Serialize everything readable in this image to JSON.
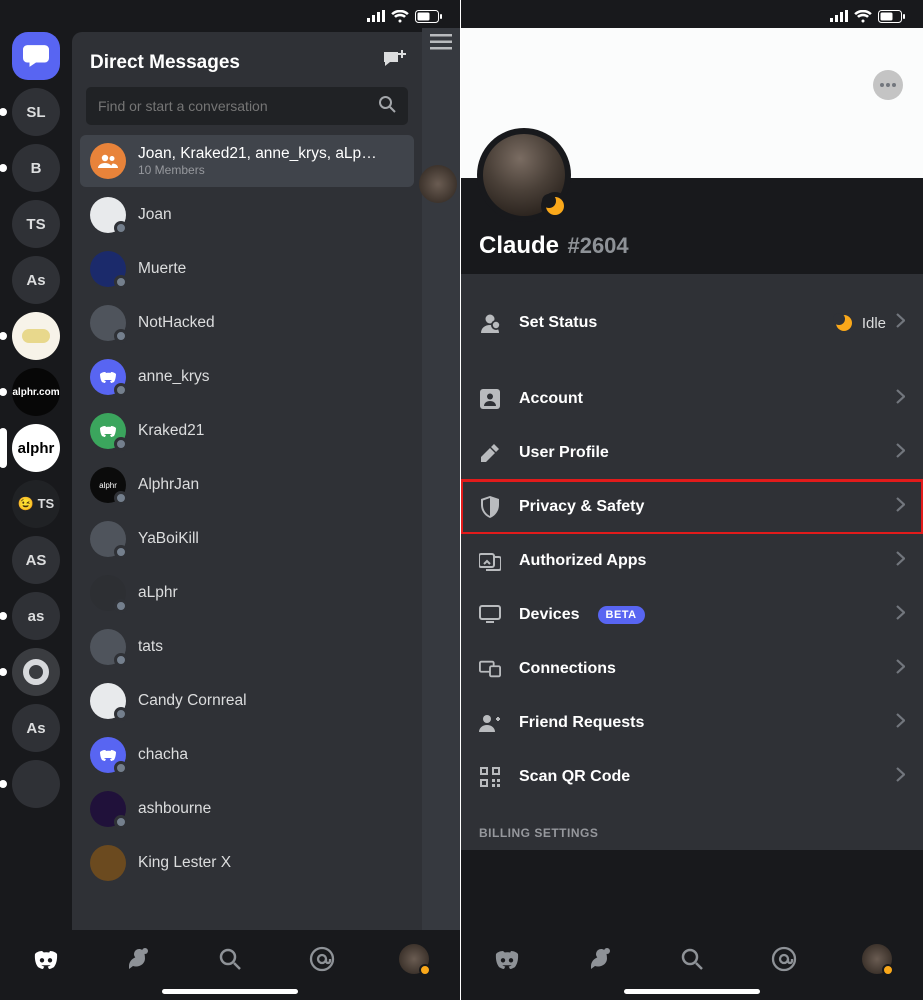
{
  "status_icons": [
    "signal",
    "wifi",
    "battery"
  ],
  "left": {
    "dm_header": "Direct Messages",
    "search_placeholder": "Find or start a conversation",
    "servers": [
      {
        "label": "",
        "kind": "home-active"
      },
      {
        "label": "SL",
        "kind": "txt"
      },
      {
        "label": "B",
        "kind": "txt"
      },
      {
        "label": "TS",
        "kind": "txt"
      },
      {
        "label": "As",
        "kind": "txt"
      },
      {
        "label": "",
        "kind": "pill-yellow",
        "pip": true
      },
      {
        "label": "alphr.com",
        "kind": "pill-dark",
        "pip": true
      },
      {
        "label": "alphr",
        "kind": "white",
        "big_pip": true
      },
      {
        "label": "😉 TS",
        "kind": "pill-ts"
      },
      {
        "label": "AS",
        "kind": "txt"
      },
      {
        "label": "as",
        "kind": "txt"
      },
      {
        "label": "",
        "kind": "ring"
      },
      {
        "label": "As",
        "kind": "txt"
      },
      {
        "label": "",
        "kind": "txt"
      }
    ],
    "group": {
      "title": "Joan, Kraked21, anne_krys, aLph...",
      "members": "10 Members"
    },
    "dms": [
      {
        "name": "Joan",
        "avatar": "light"
      },
      {
        "name": "Muerte",
        "avatar": "bluedark"
      },
      {
        "name": "NotHacked",
        "avatar": "photo"
      },
      {
        "name": "anne_krys",
        "avatar": "blurple"
      },
      {
        "name": "Kraked21",
        "avatar": "green"
      },
      {
        "name": "AlphrJan",
        "avatar": "pill-dark"
      },
      {
        "name": "YaBoiKill",
        "avatar": "photo"
      },
      {
        "name": "aLphr",
        "avatar": "gray"
      },
      {
        "name": "tats",
        "avatar": "photo"
      },
      {
        "name": "Candy Cornreal",
        "avatar": "photo"
      },
      {
        "name": "chacha",
        "avatar": "blurple"
      },
      {
        "name": "ashbourne",
        "avatar": "purple"
      },
      {
        "name": "King Lester X",
        "avatar": "photo"
      }
    ]
  },
  "right": {
    "username": "Claude",
    "discriminator": "#2604",
    "status_row_label": "Set Status",
    "status_value": "Idle",
    "rows": [
      {
        "icon": "account",
        "label": "Account"
      },
      {
        "icon": "pencil",
        "label": "User Profile"
      },
      {
        "icon": "shield",
        "label": "Privacy & Safety",
        "highlight": true
      },
      {
        "icon": "apps",
        "label": "Authorized Apps"
      },
      {
        "icon": "monitor",
        "label": "Devices",
        "badge": "BETA"
      },
      {
        "icon": "link",
        "label": "Connections"
      },
      {
        "icon": "friend",
        "label": "Friend Requests"
      },
      {
        "icon": "qr",
        "label": "Scan QR Code"
      }
    ],
    "billing_title": "BILLING SETTINGS"
  }
}
